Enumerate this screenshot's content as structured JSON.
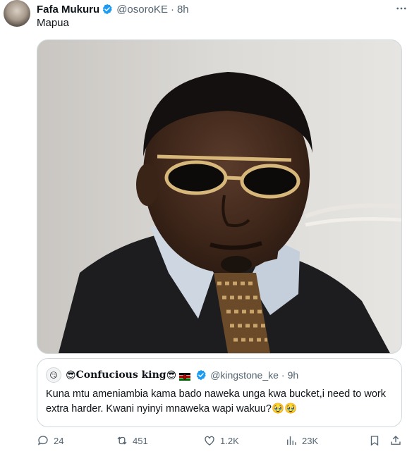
{
  "author": {
    "name": "Fafa Mukuru",
    "handle": "@osoroKE",
    "separator": "·",
    "time": "8h"
  },
  "tweet": {
    "text": "Mapua"
  },
  "quote": {
    "name": "Confucious king",
    "name_prefix_emoji": "😎",
    "name_suffix_emoji": "😎",
    "handle": "@kingstone_ke",
    "separator": "·",
    "time": "9h",
    "text": "Kuna mtu ameniambia kama bado naweka unga kwa bucket,i need to work extra harder. Kwani nyinyi mnaweka wapi wakuu?🥹🥹"
  },
  "actions": {
    "replies": "24",
    "reposts": "451",
    "likes": "1.2K",
    "views": "23K"
  },
  "colors": {
    "verified": "#1d9bf0",
    "secondary_text": "#536471",
    "border": "#cfd9de"
  },
  "icons": [
    "verified-badge-icon",
    "more-options-icon",
    "reply-icon",
    "repost-icon",
    "like-icon",
    "views-icon",
    "bookmark-icon",
    "share-icon",
    "kenya-flag-icon"
  ]
}
